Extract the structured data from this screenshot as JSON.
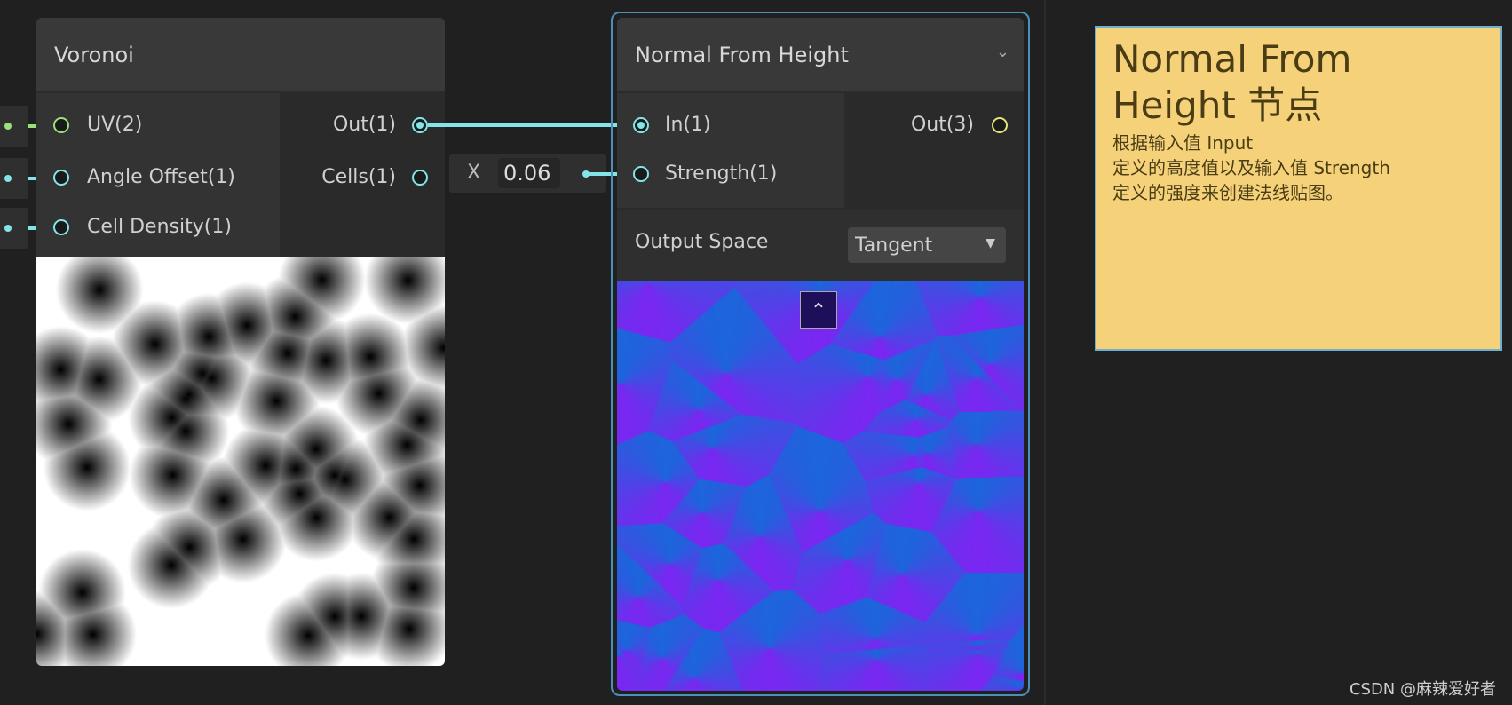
{
  "voronoi_node": {
    "title": "Voronoi",
    "inputs": [
      {
        "label": "UV(2)",
        "color": "#9ae07c"
      },
      {
        "label": "Angle Offset(1)",
        "color": "#84e4e7"
      },
      {
        "label": "Cell Density(1)",
        "color": "#84e4e7"
      }
    ],
    "outputs": [
      {
        "label": "Out(1)",
        "connected": true
      },
      {
        "label": "Cells(1)",
        "connected": false
      }
    ]
  },
  "strength_input": {
    "axis_label": "X",
    "value": "0.06"
  },
  "normal_node": {
    "title": "Normal From Height",
    "collapse_icon": "chevron-down-icon",
    "inputs": [
      {
        "label": "In(1)",
        "connected": true
      },
      {
        "label": "Strength(1)",
        "connected": true
      }
    ],
    "output": {
      "label": "Out(3)",
      "color": "#e0e27c"
    },
    "output_space_label": "Output Space",
    "output_space_value": "Tangent",
    "preview_toggle_icon": "chevron-up-icon"
  },
  "sticky_note": {
    "title": "Normal From Height 节点",
    "body_lines": [
      "根据输入值 Input",
      "定义的高度值以及输入值 Strength",
      "定义的强度来创建法线贴图。"
    ],
    "color": "#f5d27a"
  },
  "watermark": "CSDN @麻辣爱好者",
  "colors": {
    "wire_float": "#84e4e7",
    "wire_vec2": "#9ae07c",
    "selection": "#4a90b8"
  }
}
